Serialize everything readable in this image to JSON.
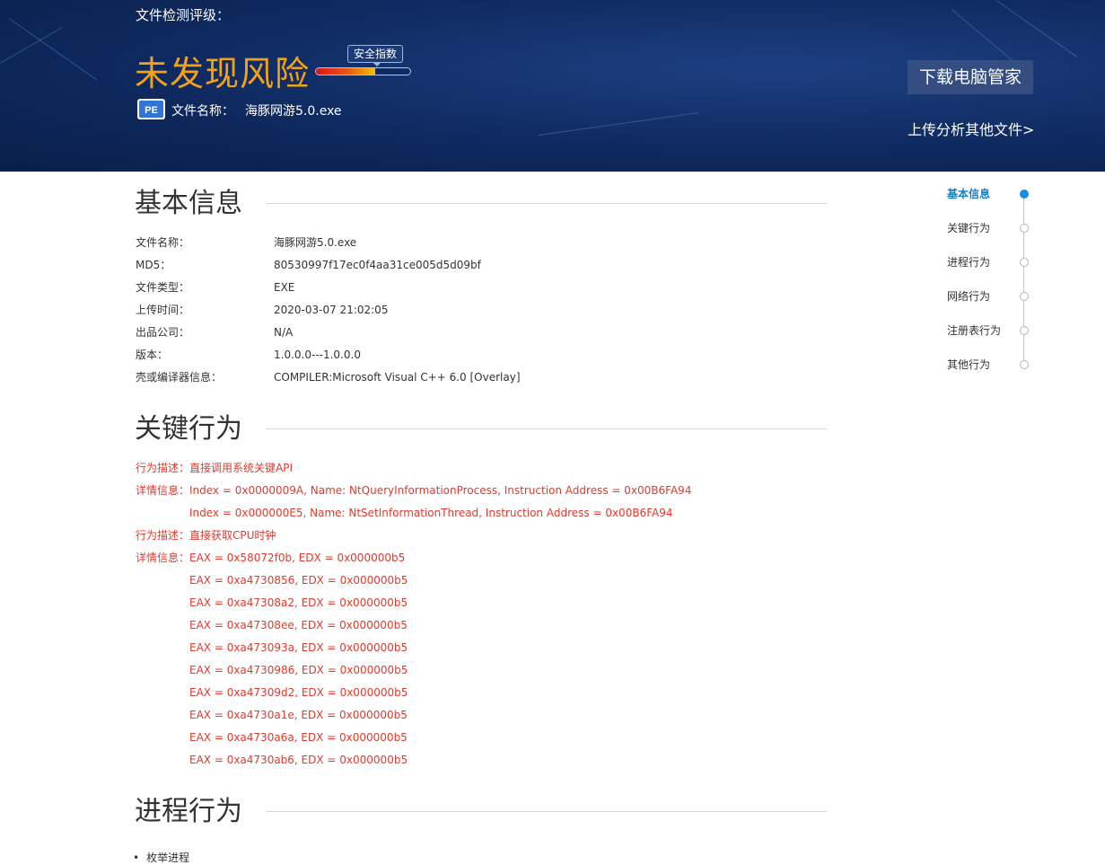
{
  "header": {
    "rating_label": "文件检测评级：",
    "verdict": "未发现风险",
    "security_index_label": "安全指数",
    "security_index_fraction": 0.63,
    "file_icon_text": "PE",
    "file_name_label": "文件名称：",
    "file_name": "海豚网游5.0.exe",
    "download_button": "下载电脑管家",
    "upload_link": "上传分析其他文件>"
  },
  "basic_info": {
    "title": "基本信息",
    "rows": [
      {
        "label": "文件名称：",
        "value": "海豚网游5.0.exe"
      },
      {
        "label": "MD5：",
        "value": "80530997f17ec0f4aa31ce005d5d09bf"
      },
      {
        "label": "文件类型：",
        "value": "EXE"
      },
      {
        "label": "上传时间：",
        "value": "2020-03-07 21:02:05"
      },
      {
        "label": "出品公司：",
        "value": "N/A"
      },
      {
        "label": "版本：",
        "value": "1.0.0.0---1.0.0.0"
      },
      {
        "label": "壳或编译器信息：",
        "value": "COMPILER:Microsoft Visual C++ 6.0 [Overlay]"
      }
    ]
  },
  "key_behavior": {
    "title": "关键行为",
    "desc_label": "行为描述：",
    "detail_label": "详情信息：",
    "item1_desc": "直接调用系统关键API",
    "item1_details": [
      "Index = 0x0000009A, Name: NtQueryInformationProcess, Instruction Address = 0x00B6FA94",
      "Index = 0x000000E5, Name: NtSetInformationThread, Instruction Address = 0x00B6FA94"
    ],
    "item2_desc": "直接获取CPU时钟",
    "item2_details": [
      "EAX = 0x58072f0b, EDX = 0x000000b5",
      "EAX = 0xa4730856, EDX = 0x000000b5",
      "EAX = 0xa47308a2, EDX = 0x000000b5",
      "EAX = 0xa47308ee, EDX = 0x000000b5",
      "EAX = 0xa473093a, EDX = 0x000000b5",
      "EAX = 0xa4730986, EDX = 0x000000b5",
      "EAX = 0xa47309d2, EDX = 0x000000b5",
      "EAX = 0xa4730a1e, EDX = 0x000000b5",
      "EAX = 0xa4730a6a, EDX = 0x000000b5",
      "EAX = 0xa4730ab6, EDX = 0x000000b5"
    ]
  },
  "process_behavior": {
    "title": "进程行为",
    "first_item": "枚举进程"
  },
  "side_nav": {
    "items": [
      "基本信息",
      "关键行为",
      "进程行为",
      "网络行为",
      "注册表行为",
      "其他行为"
    ],
    "active_index": 0
  },
  "colors": {
    "verdict": "#f2a21a",
    "behavior_text": "#e03a2c",
    "nav_active": "#1a8de0"
  }
}
